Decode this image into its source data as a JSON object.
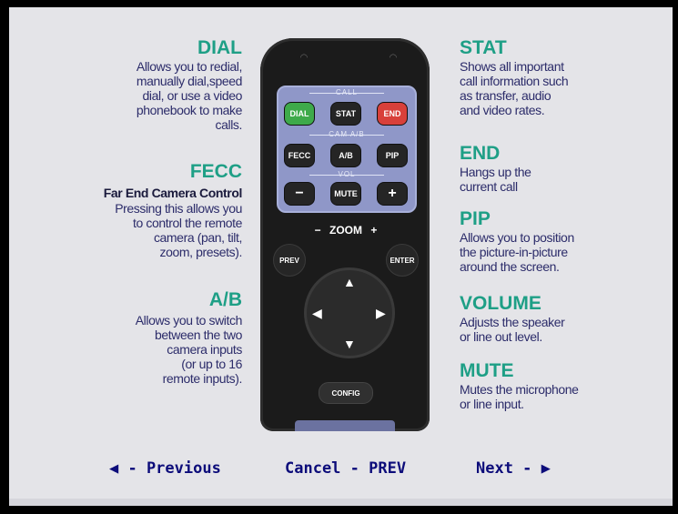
{
  "left": [
    {
      "id": "dial",
      "title": "DIAL",
      "lines": [
        "Allows you to redial,",
        "manually dial,speed",
        "dial, or use a video",
        "phonebook to make",
        "calls."
      ]
    },
    {
      "id": "fecc",
      "title": "FECC",
      "subtitle": "Far End Camera Control",
      "lines": [
        "Pressing this allows you",
        "to control the remote",
        "camera (pan, tilt,",
        "zoom, presets)."
      ]
    },
    {
      "id": "ab",
      "title": "A/B",
      "lines": [
        "Allows you to switch",
        "between the two",
        "camera inputs",
        "(or up to 16",
        "remote inputs)."
      ]
    }
  ],
  "right": [
    {
      "id": "stat",
      "title": "STAT",
      "lines": [
        "Shows all important",
        "call information such",
        "as transfer, audio",
        "and video rates."
      ]
    },
    {
      "id": "end",
      "title": "END",
      "lines": [
        "Hangs up the",
        "current call"
      ]
    },
    {
      "id": "pip",
      "title": "PIP",
      "lines": [
        "Allows you to position",
        "the picture-in-picture",
        "around the screen."
      ]
    },
    {
      "id": "volume",
      "title": "VOLUME",
      "lines": [
        "Adjusts the speaker",
        "or line out level."
      ]
    },
    {
      "id": "mute",
      "title": "MUTE",
      "lines": [
        "Mutes the microphone",
        "or line input."
      ]
    }
  ],
  "remote": {
    "group_call": "CALL",
    "group_cam": "CAM A/B",
    "group_vol": "VOL",
    "dial": "DIAL",
    "stat": "STAT",
    "end": "END",
    "fecc": "FECC",
    "ab": "A/B",
    "pip": "PIP",
    "minus": "−",
    "mute": "MUTE",
    "plus": "+",
    "zoom": "ZOOM",
    "zoom_minus": "−",
    "zoom_plus": "+",
    "prev": "PREV",
    "enter": "ENTER",
    "config": "CONFIG"
  },
  "nav": {
    "previous": "◀ - Previous",
    "cancel": "Cancel - PREV",
    "next": "Next - ▶"
  },
  "colors": {
    "heading": "#1e9f86",
    "text": "#2c2c6a",
    "nav": "#0c0c7a",
    "background": "#e4e4e8"
  }
}
